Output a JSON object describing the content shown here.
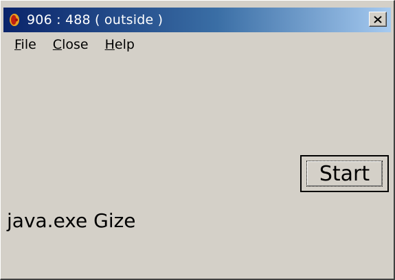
{
  "window": {
    "title": "906 : 488 ( outside )",
    "close_glyph": "×"
  },
  "menu": {
    "items": [
      {
        "mnemonic": "F",
        "rest": "ile"
      },
      {
        "mnemonic": "C",
        "rest": "lose"
      },
      {
        "mnemonic": "H",
        "rest": "elp"
      }
    ]
  },
  "main": {
    "start_label": "Start",
    "status_text": "java.exe Gize"
  },
  "icons": {
    "app": "java-coffee-icon",
    "close": "close-icon"
  },
  "colors": {
    "title_gradient_start": "#0a246a",
    "title_gradient_end": "#a6caf0",
    "face": "#d4d0c8"
  }
}
